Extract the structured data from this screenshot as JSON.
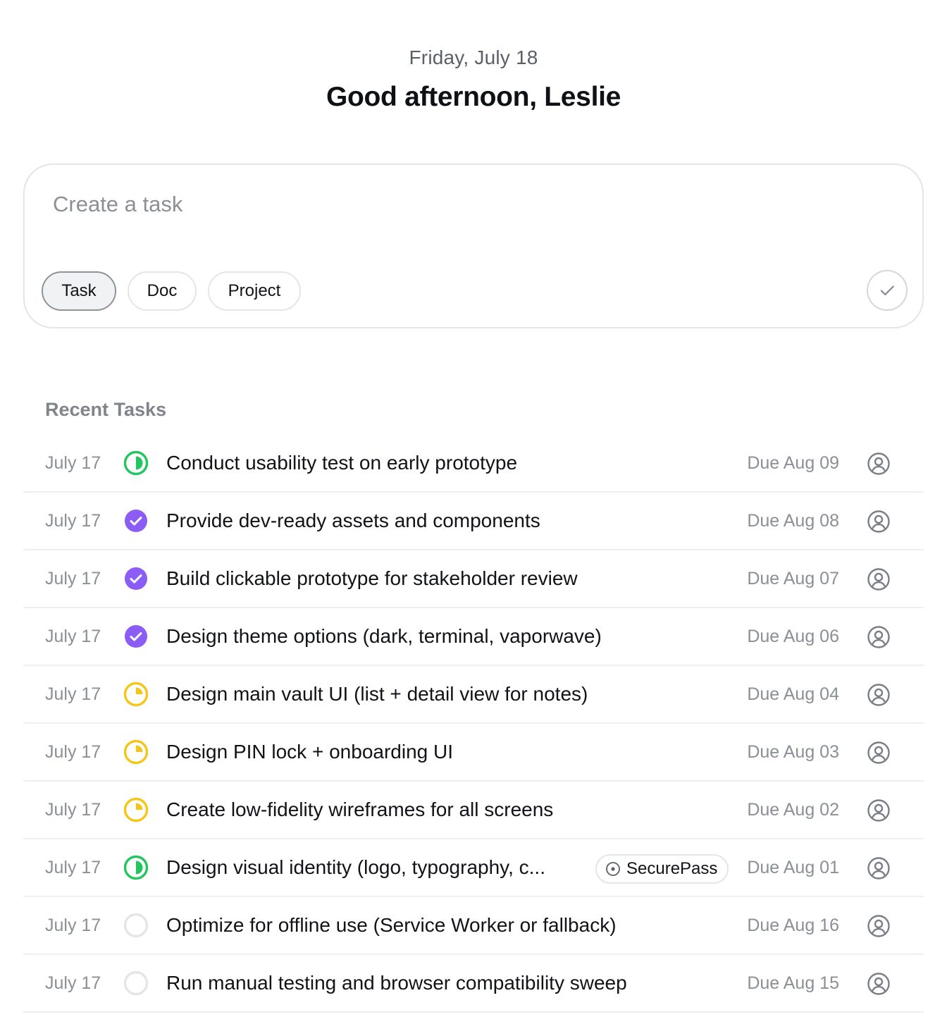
{
  "header": {
    "date": "Friday, July 18",
    "greeting": "Good afternoon, Leslie"
  },
  "composer": {
    "placeholder": "Create a task",
    "types": [
      "Task",
      "Doc",
      "Project"
    ],
    "active_type": "Task"
  },
  "recent": {
    "title": "Recent Tasks",
    "tasks": [
      {
        "date": "July 17",
        "status": "in-progress-half",
        "title": "Conduct usability test on early prototype",
        "due": "Due Aug 09"
      },
      {
        "date": "July 17",
        "status": "done",
        "title": "Provide dev-ready assets and components",
        "due": "Due Aug 08"
      },
      {
        "date": "July 17",
        "status": "done",
        "title": "Build clickable prototype for stakeholder review",
        "due": "Due Aug 07"
      },
      {
        "date": "July 17",
        "status": "done",
        "title": "Design theme options (dark, terminal, vaporwave)",
        "due": "Due Aug 06"
      },
      {
        "date": "July 17",
        "status": "in-progress-quarter",
        "title": "Design main vault UI (list + detail view for notes)",
        "due": "Due Aug 04"
      },
      {
        "date": "July 17",
        "status": "in-progress-quarter",
        "title": "Design PIN lock + onboarding UI",
        "due": "Due Aug 03"
      },
      {
        "date": "July 17",
        "status": "in-progress-quarter",
        "title": "Create low-fidelity wireframes for all screens",
        "due": "Due Aug 02"
      },
      {
        "date": "July 17",
        "status": "in-progress-half",
        "title": "Design visual identity (logo, typography, c...",
        "project": "SecurePass",
        "due": "Due Aug 01"
      },
      {
        "date": "July 17",
        "status": "todo",
        "title": "Optimize for offline use (Service Worker or fallback)",
        "due": "Due Aug 16"
      },
      {
        "date": "July 17",
        "status": "todo",
        "title": "Run manual testing and browser compatibility sweep",
        "due": "Due Aug 15"
      }
    ]
  },
  "colors": {
    "green": "#22c55e",
    "purple": "#8b5cf6",
    "yellow": "#f5c518",
    "todo": "#e4e5e8"
  },
  "icons": {
    "submit": "check-icon",
    "assignee": "user-circle-icon",
    "project": "target-icon"
  }
}
